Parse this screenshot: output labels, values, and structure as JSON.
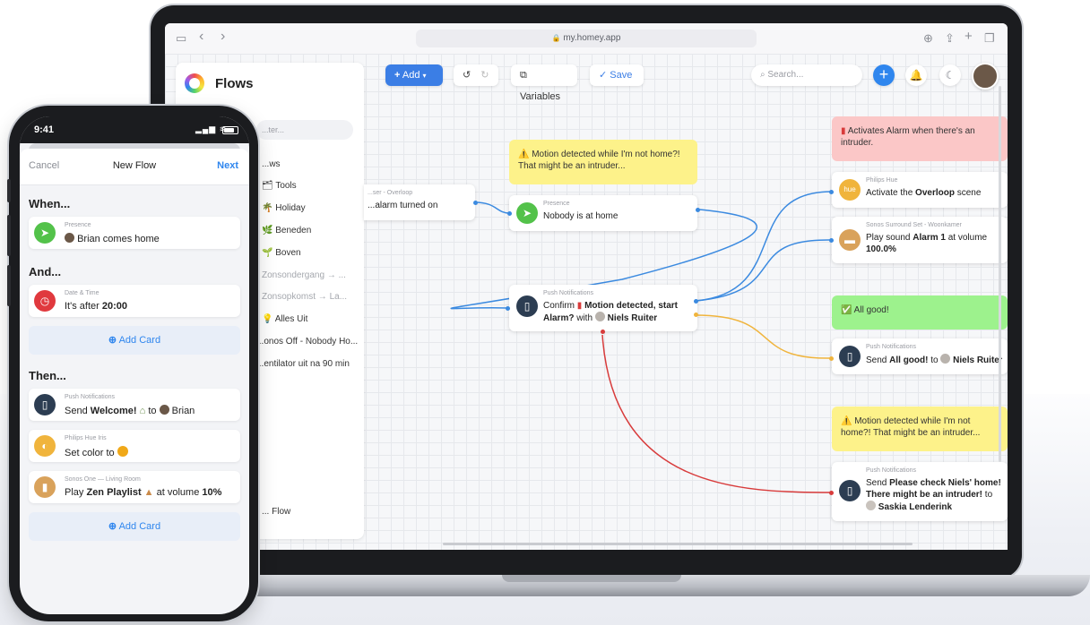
{
  "browser": {
    "url": "my.homey.app"
  },
  "app": {
    "title": "Flows",
    "toolbar": {
      "add_label": "Add",
      "variables_label": "Variables",
      "save_label": "Save",
      "search_placeholder": "Search..."
    },
    "sidebar": {
      "filter_placeholder": "...ter...",
      "section_label": "...ws",
      "items": [
        {
          "label": "Tools"
        },
        {
          "label": "Holiday"
        },
        {
          "label": "Beneden"
        },
        {
          "label": "Boven"
        },
        {
          "label": "Zonsondergang → ..."
        },
        {
          "label": "Zonsopkomst → La..."
        },
        {
          "label": "Alles Uit"
        },
        {
          "label": "...onos Off - Nobody Ho..."
        },
        {
          "label": "...entilator uit na 90 min"
        }
      ],
      "footer": "... Flow"
    }
  },
  "flow": {
    "note_top": "⚠️ Motion detected while I'm not home?! That might be an intruder...",
    "card_overloop": {
      "source": "...ser - Overloop",
      "text": "...alarm turned on"
    },
    "card_presence": {
      "source": "Presence",
      "text": "Nobody is at home"
    },
    "card_push": {
      "source": "Push Notifications",
      "text_pre": "Confirm",
      "text_bold": "Motion detected, start Alarm?",
      "text_with": "with",
      "text_person": "Niels Ruiter"
    },
    "note_alarm": "Activates Alarm when there's an intruder.",
    "card_hue": {
      "source": "Philips Hue",
      "text_pre": "Activate the",
      "text_bold": "Overloop",
      "text_post": "scene"
    },
    "card_sonos": {
      "source": "Sonos Surround Set - Woonkamer",
      "text_pre": "Play sound",
      "text_bold": "Alarm 1",
      "text_mid": "at volume",
      "text_bold2": "100.0%"
    },
    "note_allgood": "✅ All good!",
    "card_allgood": {
      "source": "Push Notifications",
      "text_pre": "Send",
      "text_bold": "All good!",
      "text_to": "to",
      "text_person": "Niels Ruiter"
    },
    "note_bottom": "⚠️ Motion detected while I'm not home?! That might be an intruder...",
    "card_check": {
      "source": "Push Notifications",
      "text_pre": "Send",
      "text_bold": "Please check Niels' home! There might be an intruder!",
      "text_to": "to",
      "text_person": "Saskia Lenderink"
    }
  },
  "phone": {
    "time": "9:41",
    "nav": {
      "cancel": "Cancel",
      "title": "New Flow",
      "next": "Next"
    },
    "when_label": "When...",
    "and_label": "And...",
    "then_label": "Then...",
    "when_card": {
      "source": "Presence",
      "text": "Brian comes home"
    },
    "and_card": {
      "source": "Date & Time",
      "text_pre": "It's after",
      "text_bold": "20:00"
    },
    "add_card": "Add Card",
    "then_cards": [
      {
        "source": "Push Notifications",
        "text_pre": "Send",
        "text_bold": "Welcome!",
        "text_to": "to",
        "text_person": "Brian"
      },
      {
        "source": "Philips Hue Iris",
        "text": "Set color to"
      },
      {
        "source": "Sonos One — Living Room",
        "text_pre": "Play",
        "text_bold": "Zen Playlist",
        "text_mid": "at volume",
        "text_bold2": "10%"
      }
    ]
  },
  "colors": {
    "accent": "#2f86ee",
    "note_yellow": "#fdf28a",
    "note_red": "#fbc7c7",
    "note_green": "#9df28d",
    "wire_blue": "#3b8ae0",
    "wire_red": "#d83b3b",
    "wire_orange": "#f0b43c"
  }
}
